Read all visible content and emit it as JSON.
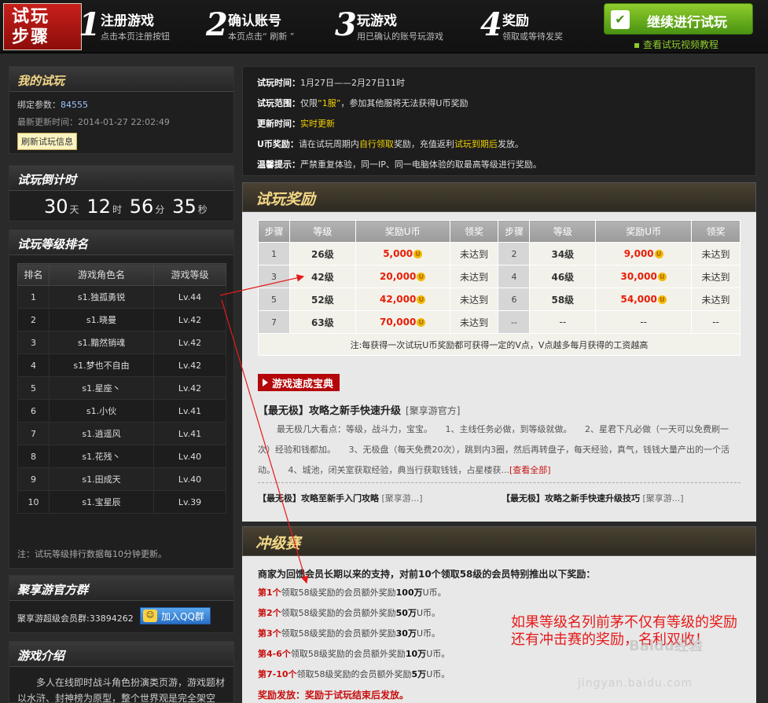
{
  "banner": {
    "badge_line1": "试玩",
    "badge_line2": "步骤",
    "steps": [
      {
        "num": "1",
        "title": "注册游戏",
        "sub": "点击本页注册按钮"
      },
      {
        "num": "2",
        "title": "确认账号",
        "sub": "本页点击“ 刷新 ”"
      },
      {
        "num": "3",
        "title": "玩游戏",
        "sub": "用已确认的账号玩游戏"
      },
      {
        "num": "4",
        "title": "奖励",
        "sub": "领取或等待发奖"
      }
    ],
    "continue_label": "继续进行试玩",
    "video_link": "查看试玩视频教程"
  },
  "my_trial": {
    "title": "我的试玩",
    "bind_label": "绑定参数：",
    "bind_value": "84555",
    "updated_label": "最新更新时间：",
    "updated_value": "2014-01-27 22:02:49",
    "refresh_label": "刷新试玩信息"
  },
  "countdown": {
    "title": "试玩倒计时",
    "days": "30",
    "days_unit": "天",
    "hours": "12",
    "hours_unit": "时",
    "minutes": "56",
    "minutes_unit": "分",
    "seconds": "35",
    "seconds_unit": "秒"
  },
  "ranking": {
    "title": "试玩等级排名",
    "headers": [
      "排名",
      "游戏角色名",
      "游戏等级"
    ],
    "rows": [
      [
        "1",
        "s1.独孤勇锐",
        "Lv.44"
      ],
      [
        "2",
        "s1.晓曼",
        "Lv.42"
      ],
      [
        "3",
        "s1.黯然销魂",
        "Lv.42"
      ],
      [
        "4",
        "s1.梦也不自由",
        "Lv.42"
      ],
      [
        "5",
        "s1.星座丶",
        "Lv.42"
      ],
      [
        "6",
        "s1.小伙",
        "Lv.41"
      ],
      [
        "7",
        "s1.逍遥风",
        "Lv.41"
      ],
      [
        "8",
        "s1.花残丶",
        "Lv.40"
      ],
      [
        "9",
        "s1.田成天",
        "Lv.40"
      ],
      [
        "10",
        "s1.宝星辰",
        "Lv.39"
      ]
    ],
    "note": "注：试玩等级排行数据每10分钟更新。"
  },
  "qq_group": {
    "title": "聚享游官方群",
    "text": "聚享游超级会员群:33894262",
    "button": "加入QQ群"
  },
  "game_intro": {
    "title": "游戏介绍",
    "text": "多人在线即时战斗角色扮演类页游，游戏题材以水浒、封神榜为原型，整个世界观是完全架空"
  },
  "rules": {
    "time_label": "试玩时间：",
    "time_value": "1月27日——2月27日11时",
    "range_label": "试玩范围：",
    "range_pre": "仅限",
    "range_hl": "“1服”",
    "range_post": "，参加其他服将无法获得U币奖励",
    "update_label": "更新时间：",
    "update_value": "实时更新",
    "reward_label": "U币奖励：",
    "reward_pre": "请在试玩周期内",
    "reward_hl1": "自行领取",
    "reward_mid": "奖励，充值返利",
    "reward_hl2": "试玩到期后",
    "reward_post": "发放。",
    "tip_label": "温馨提示：",
    "tip_value": "严禁重复体验，同一IP、同一电脑体验的取最高等级进行奖励。"
  },
  "reward": {
    "title": "试玩奖励",
    "headers": [
      "步骤",
      "等级",
      "奖励U币",
      "领奖",
      "步骤",
      "等级",
      "奖励U币",
      "领奖"
    ],
    "rows": [
      [
        "1",
        "26级",
        "5,000",
        "未达到",
        "2",
        "34级",
        "9,000",
        "未达到"
      ],
      [
        "3",
        "42级",
        "20,000",
        "未达到",
        "4",
        "46级",
        "30,000",
        "未达到"
      ],
      [
        "5",
        "52级",
        "42,000",
        "未达到",
        "6",
        "58级",
        "54,000",
        "未达到"
      ],
      [
        "7",
        "63级",
        "70,000",
        "未达到",
        "--",
        "--",
        "--",
        "--"
      ]
    ],
    "coin_glyph": "U",
    "note": "注:每获得一次试玩U币奖励都可获得一定的V点，V点越多每月获得的工资越高"
  },
  "guide": {
    "tag": "游戏速成宝典",
    "title": "【最无极】攻略之新手快速升级",
    "title_src": "[聚享游官方]",
    "text": "最无极几大看点：等级，战斗力，宝宝。　　1、主线任务必做，到等级就做。　　2、星君下凡必做（一天可以免费刷一次）经验和钱都加。　　3、无极盘（每天免费20次），跳到内3圈，然后再转盘子，每天经验，真气，钱钱大量产出的一个活动。　　4、城池，闭关室获取经验，典当行获取钱钱，占星楼获...",
    "more": "[查看全部]",
    "link1": "【最无极】攻略至新手入门攻略",
    "link1_src": "[聚享游...]",
    "link2": "【最无极】攻略之新手快速升级技巧",
    "link2_src": "[聚享游...]"
  },
  "rush": {
    "title": "冲级赛",
    "intro": "商家为回馈会员长期以来的支持，对前10个领取58级的会员特别推出以下奖励：",
    "rows": [
      {
        "rank": "第1个",
        "mid": "领取58级奖励的会员额外奖励",
        "amt": "100万",
        "unit": "U币。"
      },
      {
        "rank": "第2个",
        "mid": "领取58级奖励的会员额外奖励",
        "amt": "50万",
        "unit": "U币。"
      },
      {
        "rank": "第3个",
        "mid": "领取58级奖励的会员额外奖励",
        "amt": "30万",
        "unit": "U币。"
      },
      {
        "rank": "第4-6个",
        "mid": "领取58级奖励的会员额外奖励",
        "amt": "10万",
        "unit": "U币。"
      },
      {
        "rank": "第7-10个",
        "mid": "领取58级奖励的会员额外奖励",
        "amt": "5万",
        "unit": "U币。"
      }
    ],
    "end": "奖励发放：奖励于试玩结束后发放。"
  },
  "annotation": {
    "line1": "如果等级名列前茅不仅有等级的奖励",
    "line2": "还有冲击赛的奖励，名利双收！"
  },
  "watermark": "jingyan.baidu.com",
  "watermark_cn": "Baidu经验",
  "colors": {
    "accent_red": "#c80d0d",
    "gold": "#f4d886",
    "green": "#4a9312"
  }
}
